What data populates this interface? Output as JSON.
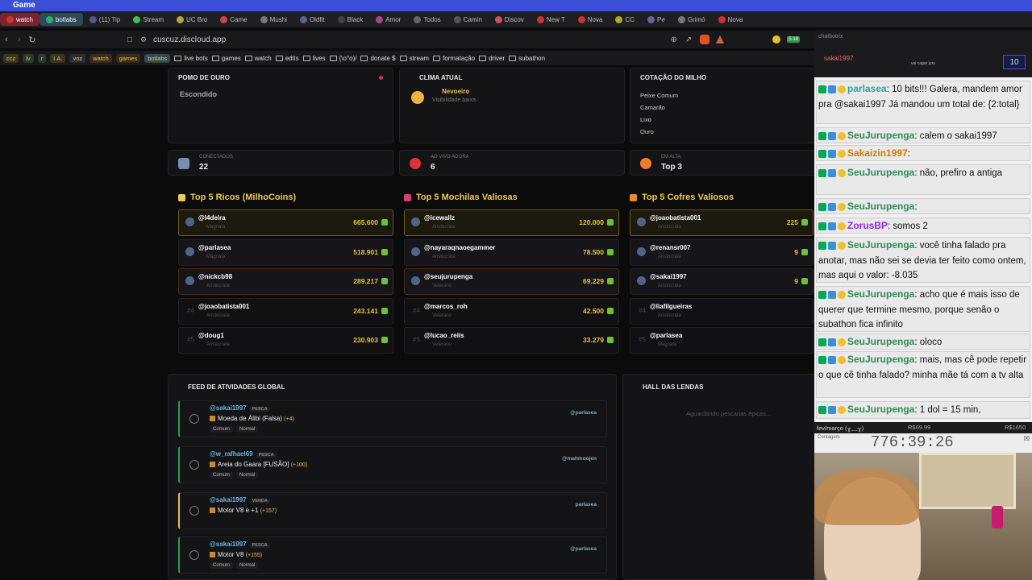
{
  "window": {
    "title": "Game"
  },
  "tabs": [
    {
      "label": "watch",
      "style": "red"
    },
    {
      "label": "botlabs",
      "style": "green"
    },
    {
      "label": "(11) Tip"
    },
    {
      "label": "Stream"
    },
    {
      "label": "UC Bro"
    },
    {
      "label": "Came"
    },
    {
      "label": "Mushi"
    },
    {
      "label": "Oldfit"
    },
    {
      "label": "Black"
    },
    {
      "label": "Amor"
    },
    {
      "label": "Todos"
    },
    {
      "label": "Camin"
    },
    {
      "label": "Discov"
    },
    {
      "label": "New T"
    },
    {
      "label": "Nova"
    },
    {
      "label": "CC"
    },
    {
      "label": "Pe"
    },
    {
      "label": "Grimó"
    },
    {
      "label": "Nova"
    }
  ],
  "address": {
    "url": "cuscuz.discloud.app",
    "ext_badge": "5.18"
  },
  "bookmarks": {
    "chips": [
      "ccz",
      "lv",
      "r",
      "I.A.",
      "voz",
      "watch",
      "games",
      "botlabs"
    ],
    "folders": [
      "live bots",
      "games",
      "watch",
      "edits",
      "lives",
      "(\\o°o)/",
      "donate $",
      "stream",
      "formatação",
      "driver",
      "subathon"
    ]
  },
  "top_cards": {
    "pomo": {
      "title": "POMO DE OURO",
      "status": "Escondido"
    },
    "clima": {
      "title": "CLIMA ATUAL",
      "name": "Nevoeiro",
      "desc": "Visibilidade baixa"
    },
    "cotacao": {
      "title": "COTAÇÃO DO MILHO",
      "items": [
        "Peixe Comum",
        "Camarão",
        "Lixo",
        "Ouro"
      ]
    }
  },
  "stats": [
    {
      "label": "CONECTADOS",
      "value": "22"
    },
    {
      "label": "AO VIVO AGORA",
      "value": "6"
    },
    {
      "label": "EM ALTA",
      "value": "Top 3"
    }
  ],
  "rankings": [
    {
      "title": "Top 5 Ricos (MilhoCoins)",
      "rows": [
        {
          "rank": "",
          "user": "@l4deira",
          "tier": "Magnata",
          "value": "665.600"
        },
        {
          "rank": "",
          "user": "@parlasea",
          "tier": "Magnata",
          "value": "518.901"
        },
        {
          "rank": "",
          "user": "@nickcb98",
          "tier": "Aristocrata",
          "value": "289.217"
        },
        {
          "rank": "#4",
          "user": "@joaobatista001",
          "tier": "Aristocrata",
          "value": "243.141"
        },
        {
          "rank": "#5",
          "user": "@doug1",
          "tier": "Aristocrata",
          "value": "230.903"
        }
      ]
    },
    {
      "title": "Top 5 Mochilas Valiosas",
      "rows": [
        {
          "rank": "",
          "user": "@icewallz",
          "tier": "Aristocrata",
          "value": "120.000"
        },
        {
          "rank": "",
          "user": "@nayaraqnaoegammer",
          "tier": "Aristocrata",
          "value": "78.500"
        },
        {
          "rank": "",
          "user": "@seujurupenga",
          "tier": "Veterano",
          "value": "69.229"
        },
        {
          "rank": "#4",
          "user": "@marcos_roh",
          "tier": "Veterano",
          "value": "42.500"
        },
        {
          "rank": "#5",
          "user": "@lucao_reiis",
          "tier": "Veterano",
          "value": "33.279"
        }
      ]
    },
    {
      "title": "Top 5 Cofres Valiosos",
      "rows": [
        {
          "rank": "",
          "user": "@joaobatista001",
          "tier": "Aristocrata",
          "value": "225"
        },
        {
          "rank": "",
          "user": "@renansr007",
          "tier": "Aristocrata",
          "value": "9"
        },
        {
          "rank": "",
          "user": "@sakai1997",
          "tier": "Aristocrata",
          "value": "9"
        },
        {
          "rank": "#4",
          "user": "@liafilgueiras",
          "tier": "Aristocrata",
          "value": ""
        },
        {
          "rank": "#5",
          "user": "@parlasea",
          "tier": "Magnata",
          "value": ""
        }
      ]
    }
  ],
  "feed": {
    "title": "FEED DE ATIVIDADES GLOBAL",
    "items": [
      {
        "user": "@sakai1997",
        "tag": "PESCA",
        "item": "Moeda de Álibi (Falsa)",
        "bonus": "(+4)",
        "badges": [
          "Comum",
          "Normal"
        ],
        "right": "@parlasea"
      },
      {
        "user": "@w_rafhael69",
        "tag": "PESCA",
        "item": "Areia do Gaara [FUSÃO]",
        "bonus": "(+100)",
        "badges": [
          "Comum",
          "Normal"
        ],
        "right": "@mahmoojen"
      },
      {
        "user": "@sakai1997",
        "tag": "VENDA",
        "item": "Motor V8 e +1",
        "bonus": "(+157)",
        "badges": [],
        "right": "parlasea"
      },
      {
        "user": "@sakai1997",
        "tag": "PESCA",
        "item": "Motor V8",
        "bonus": "(+155)",
        "badges": [
          "Comum",
          "Normal"
        ],
        "right": "@parlasea"
      }
    ]
  },
  "hall": {
    "title": "HALL DAS LENDAS",
    "empty": "Aguardando pescarias épicas..."
  },
  "chat": {
    "header": "chatbotrix",
    "top_user": "sakai1997",
    "top_count": "10",
    "top_note": "vai cagar juru",
    "messages": [
      {
        "user": "parlasea",
        "color": "#2aa7a0",
        "text": ": 10 bits!!! Galera, mandem amor pra @sakai1997 Já mandou um total de: {2:total}"
      },
      {
        "user": "SeuJurupenga",
        "color": "#2e8b57",
        "text": ": calem o sakai1997"
      },
      {
        "user": "Sakaizin1997",
        "color": "#d47a00",
        "text": ":"
      },
      {
        "user": "SeuJurupenga",
        "color": "#2e8b57",
        "text": ": não, prefiro a antiga"
      },
      {
        "user": "SeuJurupenga",
        "color": "#2e8b57",
        "text": ":"
      },
      {
        "user": "ZorusBP",
        "color": "#8a2be2",
        "text": ": somos 2"
      },
      {
        "user": "SeuJurupenga",
        "color": "#2e8b57",
        "text": ": você tinha falado pra anotar, mas não sei se devia ter feito como ontem, mas aqui o valor: -8.035"
      },
      {
        "user": "SeuJurupenga",
        "color": "#2e8b57",
        "text": ": acho que é mais isso de querer que termine mesmo, porque senão o subathon fica infinito"
      },
      {
        "user": "SeuJurupenga",
        "color": "#2e8b57",
        "text": ": oloco"
      },
      {
        "user": "SeuJurupenga",
        "color": "#2e8b57",
        "text": ": mais, mas cê pode repetir o que cê tinha falado? minha mãe tá com a tv alta"
      },
      {
        "user": "SeuJurupenga",
        "color": "#2e8b57",
        "text": ": 1 dol = 15 min,"
      }
    ],
    "bottom_bar": {
      "left": "fev/março (╥﹏╥)",
      "mid": "R$69.99",
      "right": "R$1650"
    }
  },
  "timer": {
    "label": "Contagem",
    "value": "776:39:26"
  },
  "colors": {
    "accent_gold": "#f2c94c",
    "chat_bg": "#e9e9e9",
    "title_blue": "#3a4fd6"
  }
}
